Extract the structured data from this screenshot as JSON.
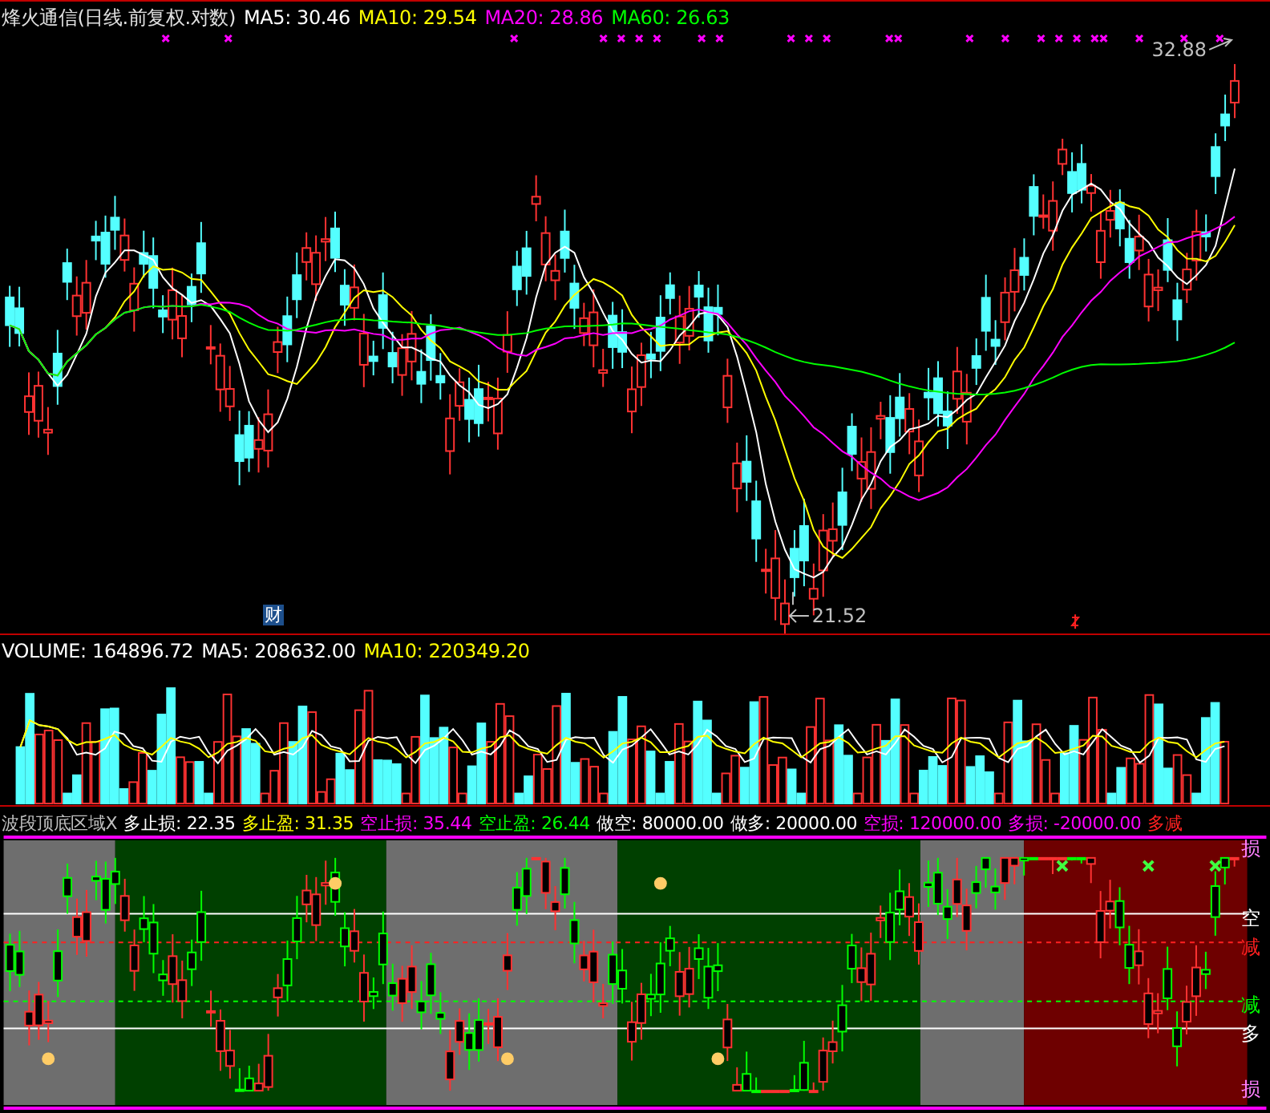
{
  "price_panel": {
    "title": "烽火通信(日线.前复权.对数)",
    "ma_labels": [
      {
        "label": "MA5: 30.46",
        "color": "#ffffff"
      },
      {
        "label": "MA10: 29.54",
        "color": "#ffff00"
      },
      {
        "label": "MA20: 28.86",
        "color": "#ff00ff"
      },
      {
        "label": "MA60: 26.63",
        "color": "#00ff00"
      }
    ],
    "high_label": "32.88",
    "low_label": "21.52",
    "finance_badge": "财"
  },
  "volume_panel": {
    "labels": [
      {
        "label": "VOLUME: 164896.72",
        "color": "#ffffff"
      },
      {
        "label": "MA5: 208632.00",
        "color": "#ffffff"
      },
      {
        "label": "MA10: 220349.20",
        "color": "#ffff00"
      }
    ]
  },
  "indicator_panel": {
    "labels": [
      {
        "label": "波段顶底区域X",
        "color": "#c0c0c0"
      },
      {
        "label": "多止损: 22.35",
        "color": "#ffffff"
      },
      {
        "label": "多止盈: 31.35",
        "color": "#ffff00"
      },
      {
        "label": "空止损: 35.44",
        "color": "#ff00ff"
      },
      {
        "label": "空止盈: 26.44",
        "color": "#00ff00"
      },
      {
        "label": "做空: 80000.00",
        "color": "#ffffff"
      },
      {
        "label": "做多: 20000.00",
        "color": "#ffffff"
      },
      {
        "label": "空损: 120000.00",
        "color": "#ff00ff"
      },
      {
        "label": "多损: -20000.00",
        "color": "#ff00ff"
      },
      {
        "label": "多减",
        "color": "#ff2020"
      }
    ],
    "zones": [
      {
        "color": "#6e6e6e"
      },
      {
        "color": "#004000"
      },
      {
        "color": "#6e6e6e"
      },
      {
        "color": "#004000"
      },
      {
        "color": "#6e6e6e"
      },
      {
        "color": "#6e0000"
      }
    ],
    "level_labels": [
      {
        "label": "损",
        "color": "#ff80ff"
      },
      {
        "label": "空",
        "color": "#ffffff"
      },
      {
        "label": "减",
        "color": "#ff2020"
      },
      {
        "label": "减",
        "color": "#00ff00"
      },
      {
        "label": "多",
        "color": "#ffffff"
      },
      {
        "label": "损",
        "color": "#ff80ff"
      }
    ]
  }
}
